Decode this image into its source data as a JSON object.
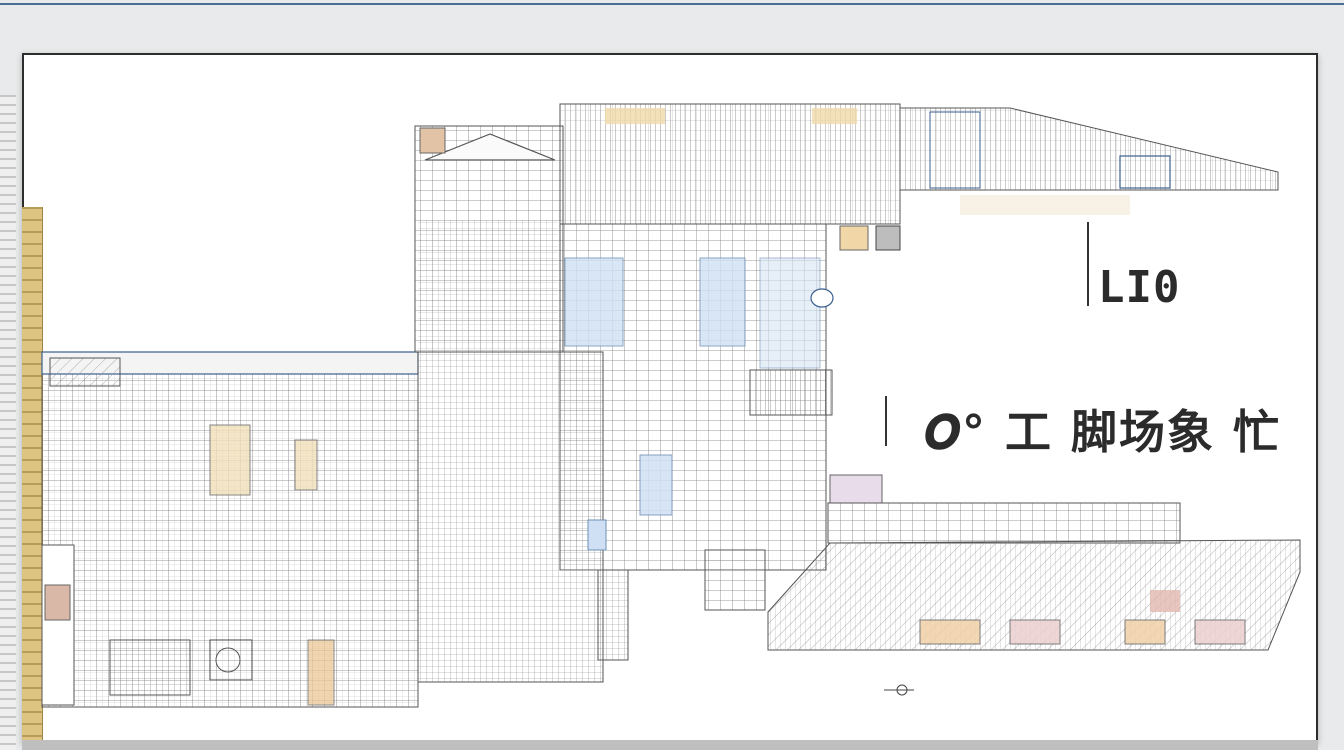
{
  "diagram": {
    "labels": {
      "upper": "LI0",
      "lower": "𝑶° 工 脚场象 忙"
    }
  },
  "colors": {
    "frame": "#2d2d2d",
    "linework": "#6b6b6b",
    "accent_blue": "#c9dbf3",
    "accent_tan": "#e8d0a8",
    "accent_pink": "#e9c8c8",
    "ruler": "#ddc480",
    "top_rule": "#4a6e94"
  }
}
